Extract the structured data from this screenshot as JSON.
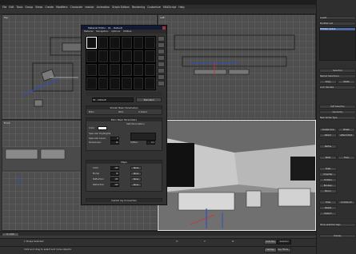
{
  "app": {
    "menus": [
      "File",
      "Edit",
      "Tools",
      "Group",
      "Views",
      "Create",
      "Modifiers",
      "Character",
      "reactor",
      "Animation",
      "Graph Editors",
      "Rendering",
      "Customize",
      "MAXScript",
      "Help"
    ]
  },
  "viewports": {
    "top_label": "Top",
    "left_label": "Left",
    "front_label": "Front",
    "perspective_label": "Perspective"
  },
  "command_panel": {
    "object_name": "Line01",
    "modifier_list": "Modifier List",
    "stack_item": "Editable Spline",
    "selection_header": "Selection",
    "named_selections": "Named Selections:",
    "copy": "Copy",
    "paste": "Paste",
    "lock_handles": "Lock Handles",
    "soft_selection": "Soft Selection",
    "geometry": "Geometry",
    "new_vertex_type": "New Vertex Type",
    "linear": "Linear",
    "bezier": "Bezier",
    "smooth": "Smooth",
    "bezier_corner": "Bezier Corner",
    "create_line": "Create Line",
    "break": "Break",
    "attach": "Attach",
    "reorient": "Reorient",
    "attach_mult": "Attach Mult.",
    "cross_section": "Cross Section",
    "refine": "Refine",
    "connect": "Connect",
    "linear_opt": "Linear",
    "closed": "Closed",
    "bind_first": "Bind first",
    "bind_last": "Bind last",
    "connect_copy": "Connect Copy",
    "weld": "Weld",
    "fuse": "Fuse",
    "cycle": "Cycle",
    "fillet": "Fillet",
    "chamfer": "Chamfer",
    "outline": "Outline",
    "boolean": "Boolean",
    "mirror": "Mirror",
    "trim": "Trim",
    "extend": "Extend",
    "hide": "Hide",
    "unhide_all": "Unhide All",
    "delete": "Delete",
    "close": "Close",
    "detach": "Detach",
    "explode": "Explode",
    "show_selected": "Show selected segs",
    "display": "Display"
  },
  "material_editor": {
    "title": "Material Editor - 01 - Default",
    "menus": [
      "Material",
      "Navigation",
      "Options",
      "Utilities"
    ],
    "material_name": "01 - Default",
    "shader_type": "Standard",
    "basic_params": "Shader Basic Parameters",
    "shader": "Blinn",
    "wire": "Wire",
    "two_sided": "2-Sided",
    "face_map": "Face Map",
    "faceted": "Faceted",
    "blinn_params": "Blinn Basic Parameters",
    "ambient": "Ambient:",
    "diffuse": "Diffuse:",
    "specular": "Specular:",
    "self_illum": "Self-Illumination",
    "color": "Color",
    "color_value": "0",
    "opacity": "Opacity:",
    "opacity_value": "100",
    "specular_highlights": "Specular Highlights",
    "spec_level": "Specular Level:",
    "spec_level_value": "0",
    "glossiness": "Glossiness:",
    "glossiness_value": "10",
    "soften": "Soften:",
    "soften_value": "0.1",
    "maps_header": "Maps",
    "maps": [
      {
        "label": "Color",
        "amount": "100",
        "map": "None"
      },
      {
        "label": "Bump",
        "amount": "30",
        "map": "None"
      },
      {
        "label": "Reflection",
        "amount": "100",
        "map": "None"
      },
      {
        "label": "Refraction",
        "amount": "100",
        "map": "None"
      }
    ],
    "mental_ray": "mental ray Connection"
  },
  "timeline": {
    "frame": "0 / 100"
  },
  "status": {
    "selection": "1 Shape Selected",
    "prompt": "Click and drag to select and move objects",
    "x": "X:",
    "y": "Y:",
    "z": "Z:",
    "auto_key": "Auto Key",
    "selected": "Selected",
    "set_key": "Set Key",
    "key_filters": "Key Filters..."
  },
  "colors": {
    "viewport_bg": "#4e4e4e",
    "grid": "#5a5a5a",
    "active_border": "#e8e8e8",
    "title_blue": "#101a35"
  }
}
